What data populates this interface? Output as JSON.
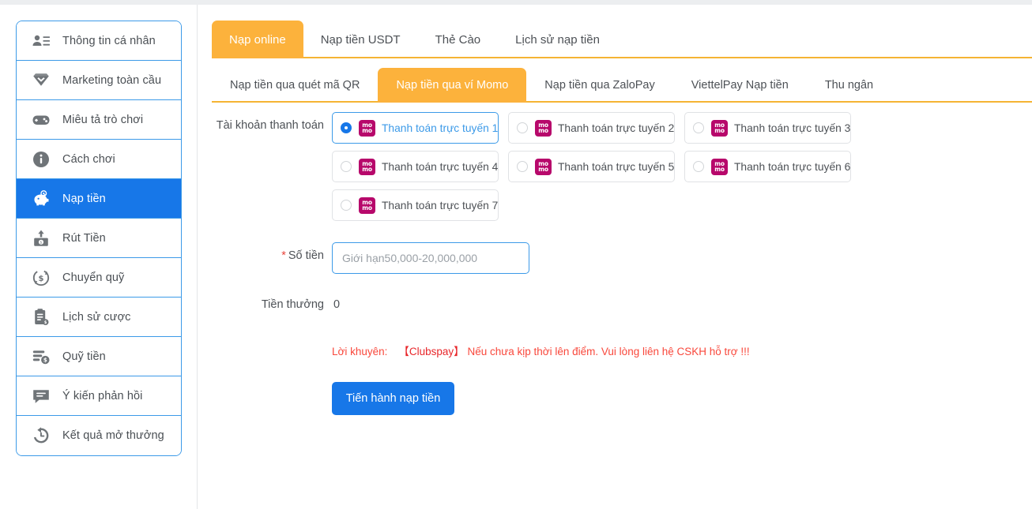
{
  "sidebar": {
    "items": [
      {
        "label": "Thông tin cá nhân",
        "icon": "user-card-icon",
        "active": false
      },
      {
        "label": "Marketing toàn cầu",
        "icon": "diamond-check-icon",
        "active": false
      },
      {
        "label": "Miêu tả trò chơi",
        "icon": "gamepad-icon",
        "active": false
      },
      {
        "label": "Cách chơi",
        "icon": "info-circle-icon",
        "active": false
      },
      {
        "label": "Nạp tiền",
        "icon": "piggy-bank-icon",
        "active": true
      },
      {
        "label": "Rút Tiền",
        "icon": "withdraw-box-icon",
        "active": false
      },
      {
        "label": "Chuyển quỹ",
        "icon": "dollar-refresh-icon",
        "active": false
      },
      {
        "label": "Lịch sử cược",
        "icon": "clipboard-dollar-icon",
        "active": false
      },
      {
        "label": "Quỹ tiền",
        "icon": "coins-dollar-icon",
        "active": false
      },
      {
        "label": "Ý kiến phản hồi",
        "icon": "chat-bubble-icon",
        "active": false
      },
      {
        "label": "Kết quả mở thưởng",
        "icon": "history-clock-icon",
        "active": false
      }
    ]
  },
  "tabs_primary": [
    {
      "label": "Nạp online",
      "active": true
    },
    {
      "label": "Nạp tiền USDT",
      "active": false
    },
    {
      "label": "Thẻ Cào",
      "active": false
    },
    {
      "label": "Lịch sử nạp tiền",
      "active": false
    }
  ],
  "tabs_secondary": [
    {
      "label": "Nạp tiền qua quét mã QR",
      "active": false
    },
    {
      "label": "Nạp tiền qua ví Momo",
      "active": true
    },
    {
      "label": "Nạp tiền qua ZaloPay",
      "active": false
    },
    {
      "label": "ViettelPay Nạp tiền",
      "active": false
    },
    {
      "label": "Thu ngân",
      "active": false
    }
  ],
  "form": {
    "account_label": "Tài khoản thanh toán",
    "accounts": [
      {
        "label": "Thanh toán trực tuyến 1",
        "logo": "momo-logo-icon",
        "selected": true
      },
      {
        "label": "Thanh toán trực tuyến 2",
        "logo": "momo-logo-icon",
        "selected": false
      },
      {
        "label": "Thanh toán trực tuyến 3",
        "logo": "momo-logo-icon",
        "selected": false
      },
      {
        "label": "Thanh toán trực tuyến 4",
        "logo": "momo-logo-icon",
        "selected": false
      },
      {
        "label": "Thanh toán trực tuyến 5",
        "logo": "momo-logo-icon",
        "selected": false
      },
      {
        "label": "Thanh toán trực tuyến 6",
        "logo": "momo-logo-icon",
        "selected": false
      },
      {
        "label": "Thanh toán trực tuyến 7",
        "logo": "momo-logo-icon",
        "selected": false
      }
    ],
    "amount_label": "Số tiền",
    "amount_required_mark": "*",
    "amount_value": "",
    "amount_placeholder": "Giới hạn50,000-20,000,000",
    "bonus_label": "Tiền thưởng",
    "bonus_value": "0",
    "notice_lead": "Lời khuyên:",
    "notice_brand": "【Clubspay】",
    "notice_text": "Nếu chưa kịp thời lên điểm. Vui lòng liên hệ CSKH hỗ trợ !!!",
    "submit_label": "Tiến hành nạp tiền"
  },
  "colors": {
    "accent_blue": "#1777e8",
    "accent_orange": "#fcb23c",
    "momo_pink": "#b7086b",
    "danger_red": "#f9483c",
    "border_blue": "#3c9ae8"
  }
}
